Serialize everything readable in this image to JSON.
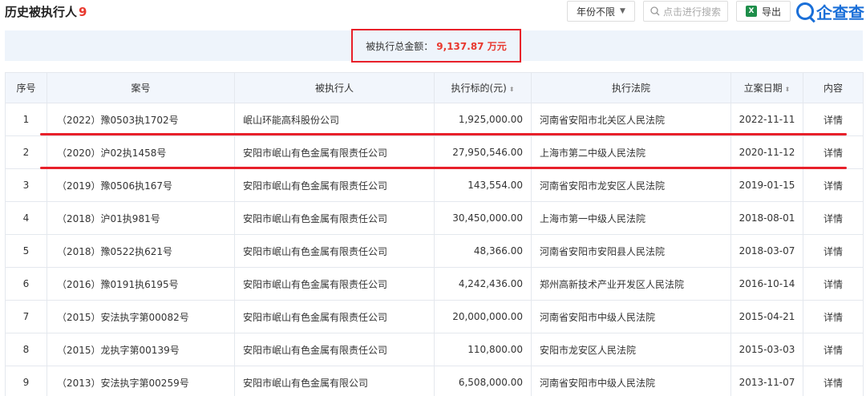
{
  "header": {
    "title": "历史被执行人",
    "count": "9",
    "year_filter": "年份不限",
    "search_placeholder": "点击进行搜索",
    "export_label": "导出",
    "brand": "企查查"
  },
  "summary": {
    "label": "被执行总金额：",
    "amount": "9,137.87 万元"
  },
  "table": {
    "columns": [
      "序号",
      "案号",
      "被执行人",
      "执行标的(元)",
      "执行法院",
      "立案日期",
      "内容"
    ],
    "rows": [
      {
        "idx": "1",
        "case": "（2022）豫0503执1702号",
        "party": "岷山环能高科股份公司",
        "amount": "1,925,000.00",
        "court": "河南省安阳市北关区人民法院",
        "date": "2022-11-11",
        "action": "详情"
      },
      {
        "idx": "2",
        "case": "（2020）沪02执1458号",
        "party": "安阳市岷山有色金属有限责任公司",
        "amount": "27,950,546.00",
        "court": "上海市第二中级人民法院",
        "date": "2020-11-12",
        "action": "详情"
      },
      {
        "idx": "3",
        "case": "（2019）豫0506执167号",
        "party": "安阳市岷山有色金属有限责任公司",
        "amount": "143,554.00",
        "court": "河南省安阳市龙安区人民法院",
        "date": "2019-01-15",
        "action": "详情"
      },
      {
        "idx": "4",
        "case": "（2018）沪01执981号",
        "party": "安阳市岷山有色金属有限责任公司",
        "amount": "30,450,000.00",
        "court": "上海市第一中级人民法院",
        "date": "2018-08-01",
        "action": "详情"
      },
      {
        "idx": "5",
        "case": "（2018）豫0522执621号",
        "party": "安阳市岷山有色金属有限责任公司",
        "amount": "48,366.00",
        "court": "河南省安阳市安阳县人民法院",
        "date": "2018-03-07",
        "action": "详情"
      },
      {
        "idx": "6",
        "case": "（2016）豫0191执6195号",
        "party": "安阳市岷山有色金属有限责任公司",
        "amount": "4,242,436.00",
        "court": "郑州高新技术产业开发区人民法院",
        "date": "2016-10-14",
        "action": "详情"
      },
      {
        "idx": "7",
        "case": "（2015）安法执字第00082号",
        "party": "安阳市岷山有色金属有限责任公司",
        "amount": "20,000,000.00",
        "court": "河南省安阳市中级人民法院",
        "date": "2015-04-21",
        "action": "详情"
      },
      {
        "idx": "8",
        "case": "（2015）龙执字第00139号",
        "party": "安阳市岷山有色金属有限责任公司",
        "amount": "110,800.00",
        "court": "安阳市龙安区人民法院",
        "date": "2015-03-03",
        "action": "详情"
      },
      {
        "idx": "9",
        "case": "（2013）安法执字第00259号",
        "party": "安阳市岷山有色金属有限公司",
        "amount": "6,508,000.00",
        "court": "河南省安阳市中级人民法院",
        "date": "2013-11-07",
        "action": "详情"
      }
    ]
  },
  "colors": {
    "accent_red": "#e8202a",
    "link_blue": "#2a7bd3",
    "brand_blue": "#1a6fd8"
  }
}
